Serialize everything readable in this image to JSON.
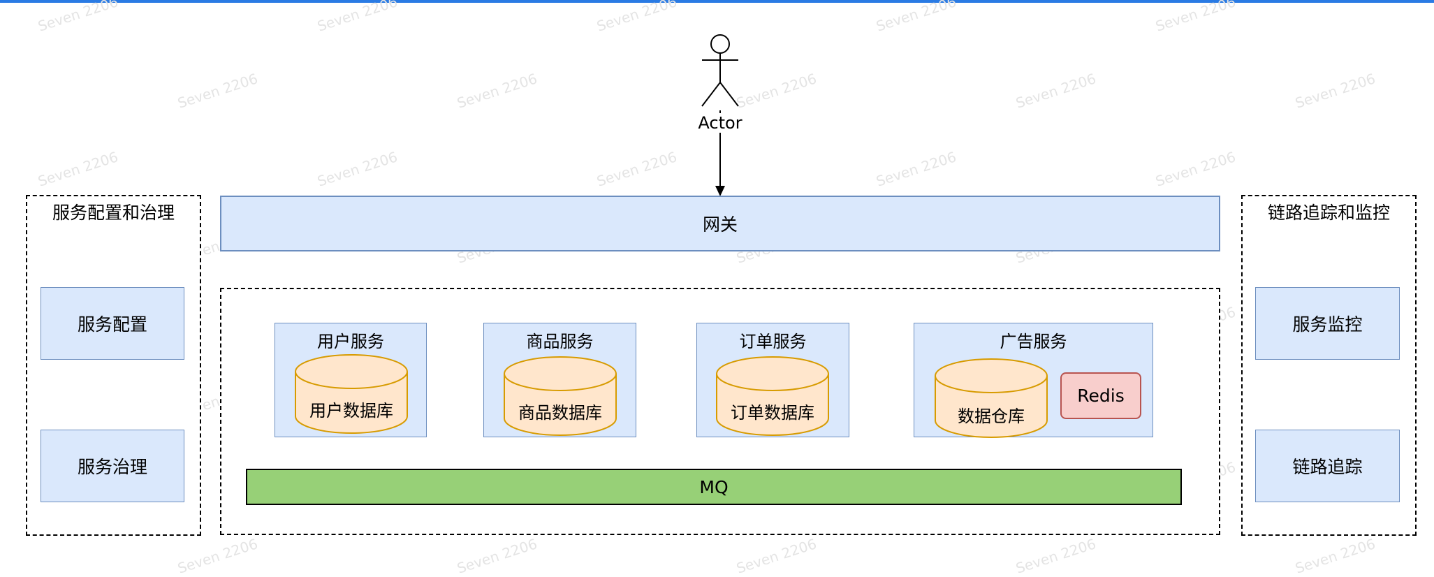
{
  "watermark": "Seven 2206",
  "actor": {
    "label": "Actor"
  },
  "gateway": {
    "label": "网关"
  },
  "left_panel": {
    "title": "服务配置和治理",
    "items": [
      "服务配置",
      "服务治理"
    ]
  },
  "right_panel": {
    "title": "链路追踪和监控",
    "items": [
      "服务监控",
      "链路追踪"
    ]
  },
  "services": [
    {
      "title": "用户服务",
      "db": "用户数据库"
    },
    {
      "title": "商品服务",
      "db": "商品数据库"
    },
    {
      "title": "订单服务",
      "db": "订单数据库"
    },
    {
      "title": "广告服务",
      "db": "数据仓库",
      "cache": "Redis"
    }
  ],
  "mq": {
    "label": "MQ"
  },
  "colors": {
    "accent_bar": "#2a7be4",
    "blue_fill": "#dae8fc",
    "blue_stroke": "#6c8ebf",
    "db_fill": "#ffe6cc",
    "db_stroke": "#d79b00",
    "mq_fill": "#97d077",
    "redis_fill": "#f8cecc",
    "redis_stroke": "#b85450"
  }
}
